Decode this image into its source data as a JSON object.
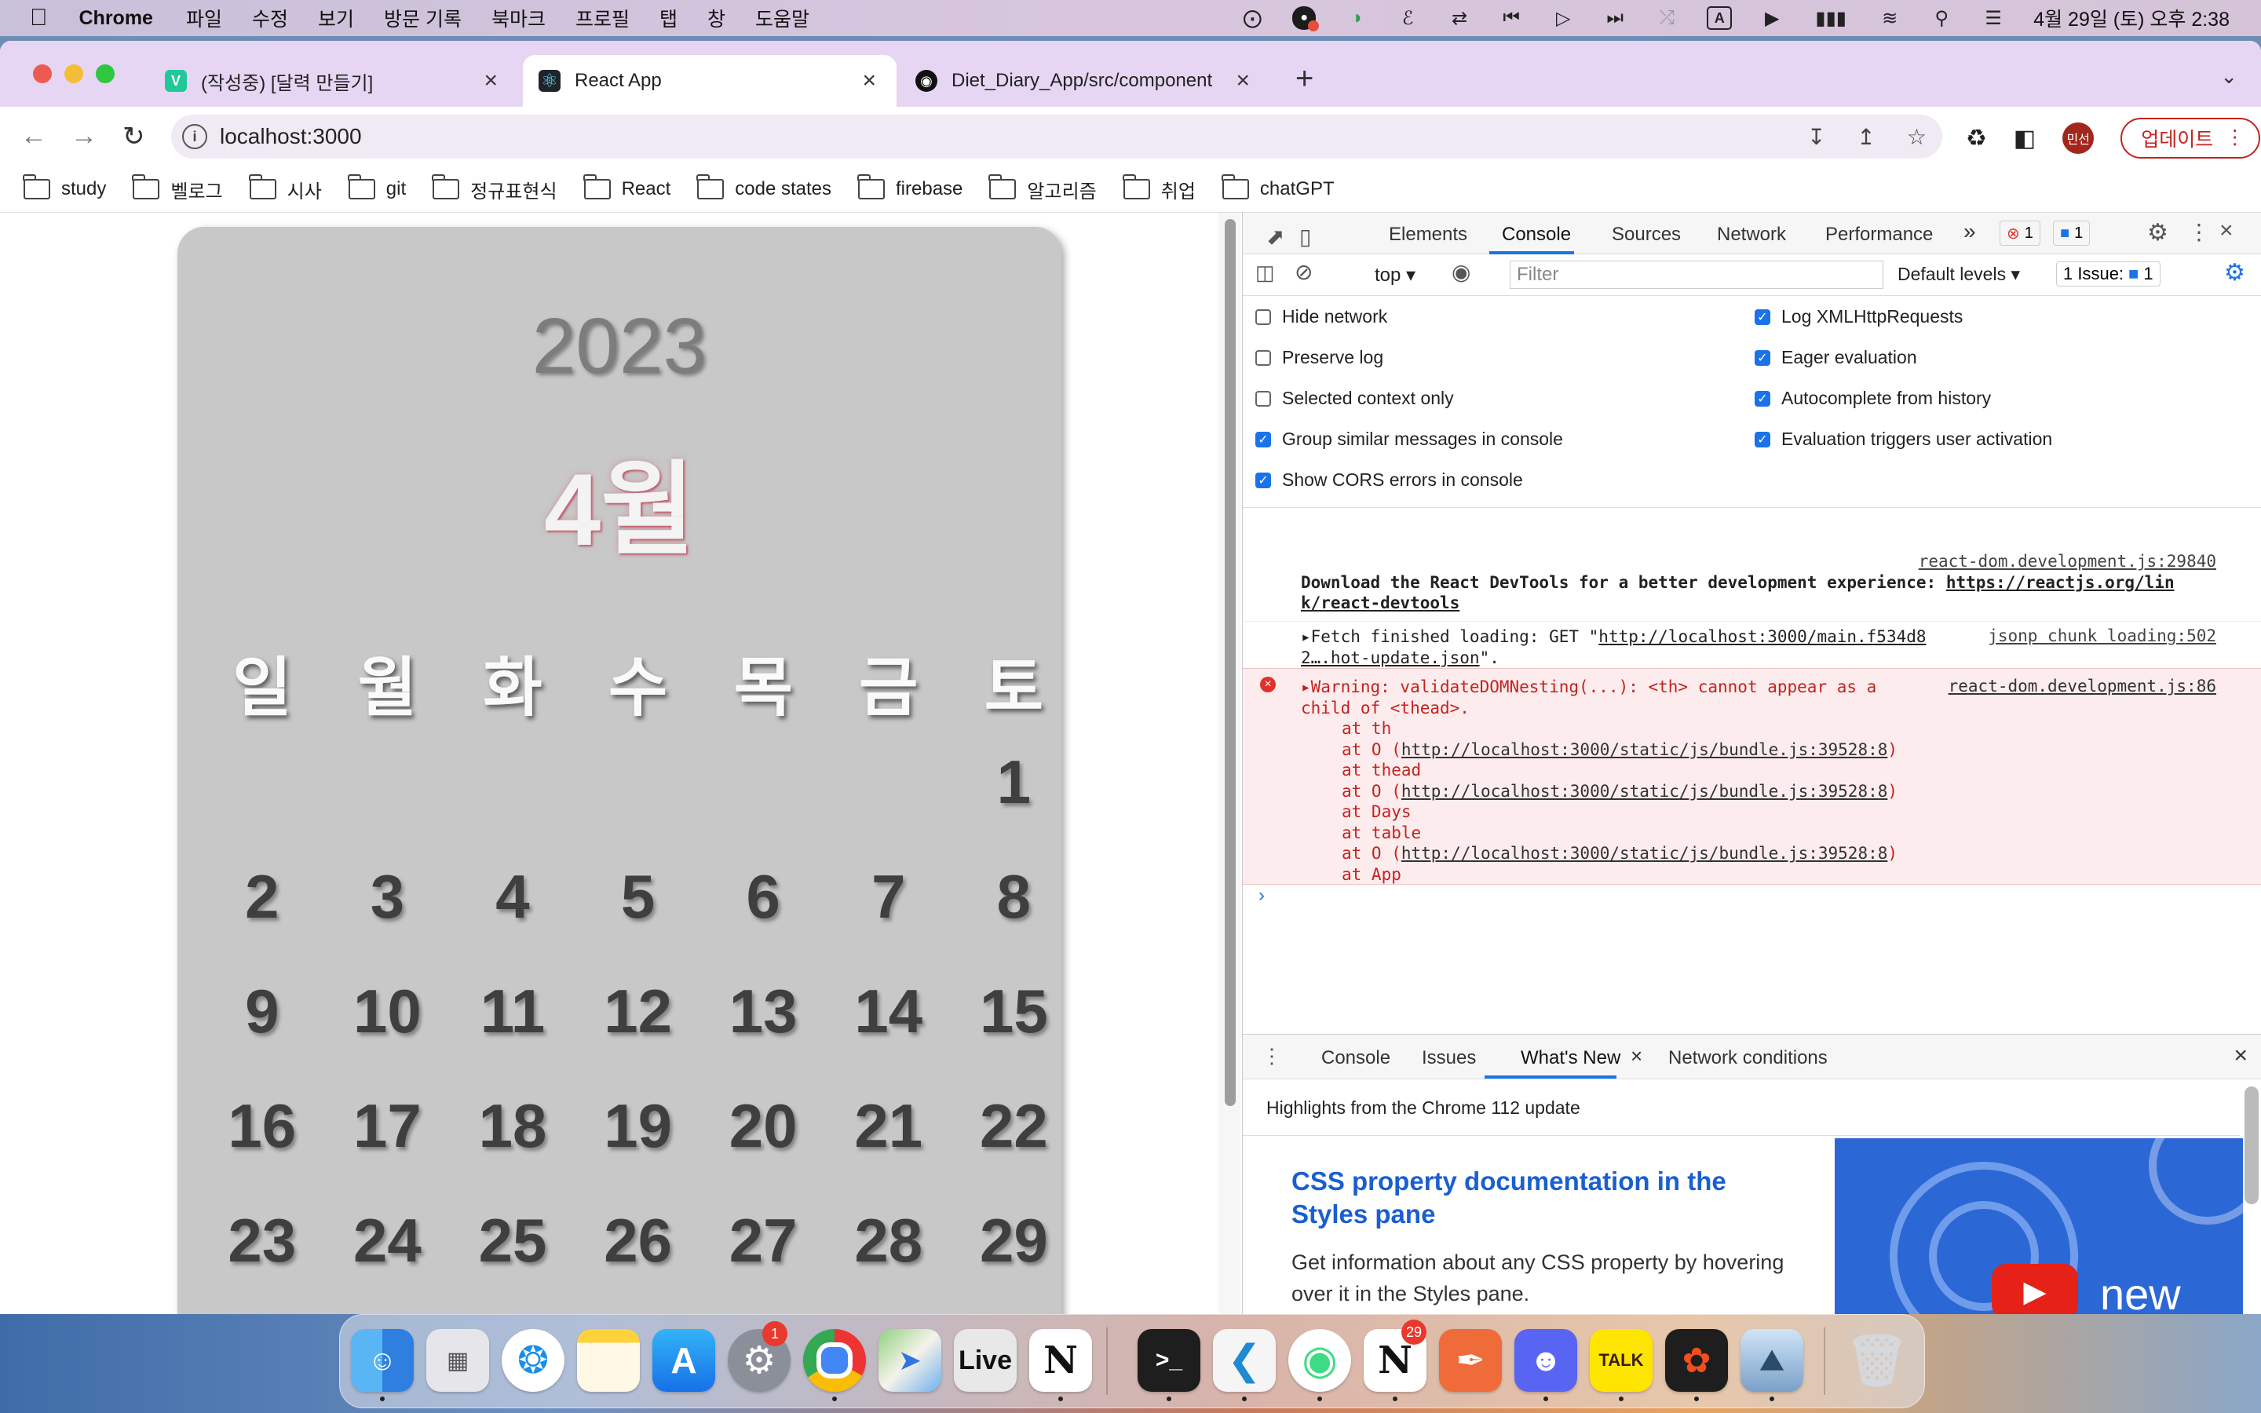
{
  "menubar": {
    "apple": "",
    "app_name": "Chrome",
    "menus": [
      "파일",
      "수정",
      "보기",
      "방문 기록",
      "북마크",
      "프로필",
      "탭",
      "창",
      "도움말"
    ],
    "input_indicator": "A",
    "datetime": "4월 29일 (토) 오후 2:38"
  },
  "browser": {
    "tabs": [
      {
        "title": "(작성중) [달력 만들기]",
        "favicon": "V",
        "active": false
      },
      {
        "title": "React App",
        "favicon": "react-icon",
        "active": true
      },
      {
        "title": "Diet_Diary_App/src/component",
        "favicon": "github-icon",
        "active": false
      }
    ],
    "url": "localhost:3000",
    "profile": "민선",
    "update_label": "업데이트",
    "bookmarks": [
      "study",
      "벨로그",
      "시사",
      "git",
      "정규표현식",
      "React",
      "code states",
      "firebase",
      "알고리즘",
      "취업",
      "chatGPT"
    ]
  },
  "calendar": {
    "year": "2023",
    "month": "4월",
    "weekdays": [
      "일",
      "월",
      "화",
      "수",
      "목",
      "금",
      "토"
    ],
    "weeks": [
      [
        "",
        "",
        "",
        "",
        "",
        "",
        "1"
      ],
      [
        "2",
        "3",
        "4",
        "5",
        "6",
        "7",
        "8"
      ],
      [
        "9",
        "10",
        "11",
        "12",
        "13",
        "14",
        "15"
      ],
      [
        "16",
        "17",
        "18",
        "19",
        "20",
        "21",
        "22"
      ],
      [
        "23",
        "24",
        "25",
        "26",
        "27",
        "28",
        "29"
      ]
    ]
  },
  "devtools": {
    "tabs": [
      "Elements",
      "Console",
      "Sources",
      "Network",
      "Performance"
    ],
    "more": "»",
    "error_count": "1",
    "message_count": "1",
    "context": "top",
    "filter_placeholder": "Filter",
    "levels": "Default levels",
    "issues_label": "1 Issue:",
    "issues_count": "1",
    "settings_left": [
      {
        "label": "Hide network",
        "checked": false
      },
      {
        "label": "Preserve log",
        "checked": false
      },
      {
        "label": "Selected context only",
        "checked": false
      },
      {
        "label": "Group similar messages in console",
        "checked": true
      },
      {
        "label": "Show CORS errors in console",
        "checked": true
      }
    ],
    "settings_right": [
      {
        "label": "Log XMLHttpRequests",
        "checked": true
      },
      {
        "label": "Eager evaluation",
        "checked": true
      },
      {
        "label": "Autocomplete from history",
        "checked": true
      },
      {
        "label": "Evaluation triggers user activation",
        "checked": true
      }
    ],
    "logs": {
      "devtools_src": "react-dom.development.js:29840",
      "devtools_msg": "Download the React DevTools for a better development experience: ",
      "devtools_link1": "https://reactjs.org/lin",
      "devtools_link2": "k/react-devtools",
      "fetch_prefix": "▸Fetch finished loading: GET \"",
      "fetch_url1": "http://localhost:3000/main.f534d8",
      "fetch_src": "jsonp chunk loading:502",
      "fetch_url2": "2….hot-update.json",
      "fetch_suffix": "\".",
      "warn_line1": "▸Warning: validateDOMNesting(...): <th> cannot appear as a",
      "warn_line2": "child of <thead>.",
      "warn_src": "react-dom.development.js:86",
      "warn_stack": [
        {
          "at": "at th",
          "url": ""
        },
        {
          "at": "at O (",
          "url": "http://localhost:3000/static/js/bundle.js:39528:8",
          "close": ")"
        },
        {
          "at": "at thead",
          "url": ""
        },
        {
          "at": "at O (",
          "url": "http://localhost:3000/static/js/bundle.js:39528:8",
          "close": ")"
        },
        {
          "at": "at Days",
          "url": ""
        },
        {
          "at": "at table",
          "url": ""
        },
        {
          "at": "at O (",
          "url": "http://localhost:3000/static/js/bundle.js:39528:8",
          "close": ")"
        },
        {
          "at": "at App",
          "url": ""
        }
      ],
      "prompt": "›"
    },
    "drawer": {
      "tabs": [
        "Console",
        "Issues",
        "What's New",
        "Network conditions"
      ],
      "highlights": "Highlights from the Chrome 112 update",
      "whatsnew_title": "CSS property documentation in the Styles pane",
      "whatsnew_desc": "Get information about any CSS property by hovering over it in the Styles pane.",
      "thumb_label": "new"
    }
  },
  "dock": {
    "apps": [
      "Finder",
      "Launchpad",
      "Safari",
      "Notes",
      "App Store",
      "System Settings",
      "Chrome",
      "Maps",
      "Live",
      "Notion",
      "Terminal",
      "VS Code",
      "Android Studio",
      "Notion 2",
      "Postman",
      "Discord",
      "KakaoTalk",
      "Figma",
      "Preview",
      "Trash"
    ],
    "settings_badge": "1",
    "notion_badge": "29",
    "live_label": "Live",
    "kakao_label": "TALK"
  }
}
